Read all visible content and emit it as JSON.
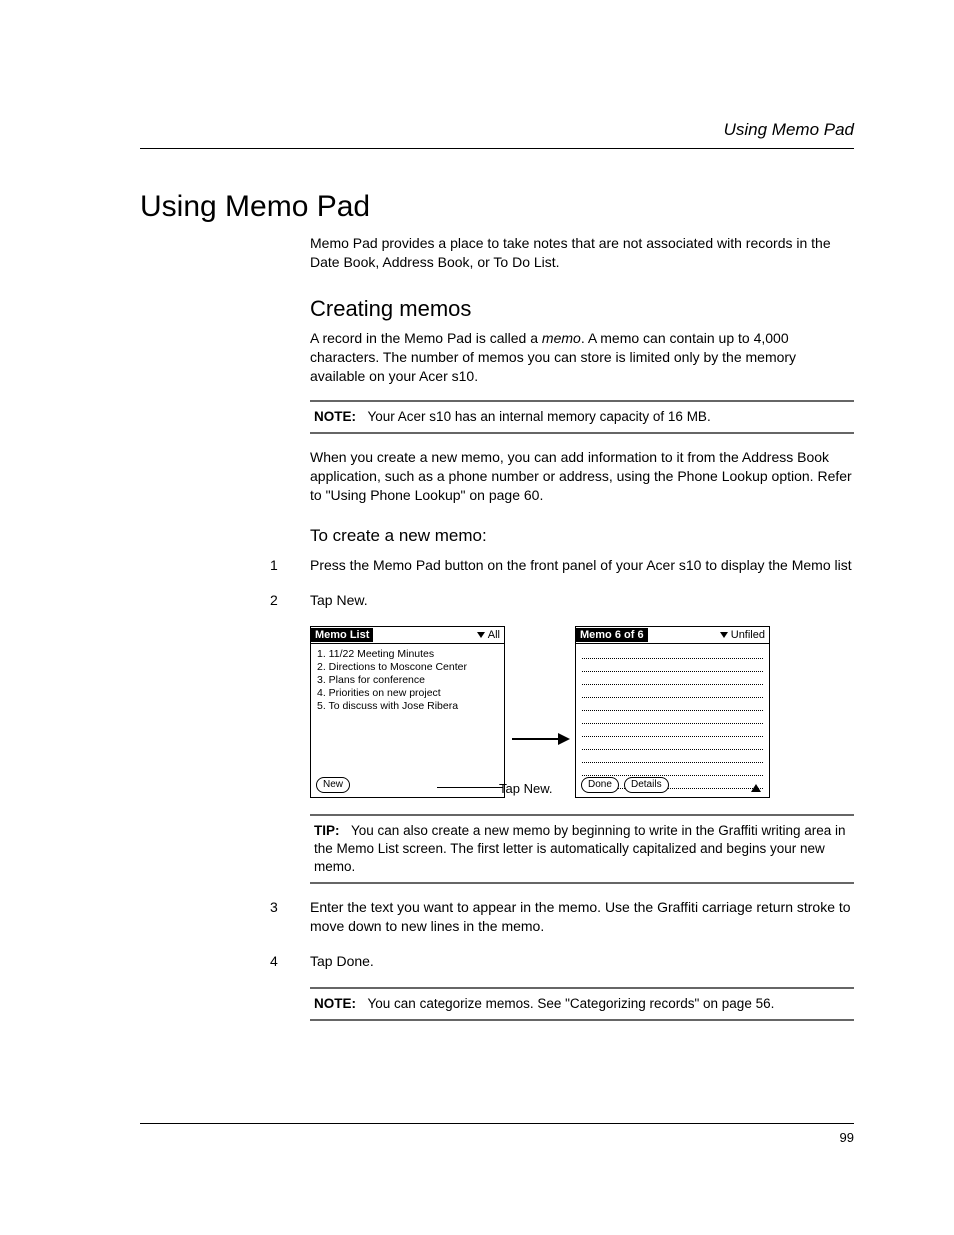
{
  "header": {
    "running_title": "Using Memo Pad"
  },
  "title": "Using Memo Pad",
  "intro": "Memo Pad provides a place to take notes that are not associated with records in the Date Book, Address Book, or To Do List.",
  "section": {
    "heading": "Creating memos",
    "p1a": "A record in the Memo Pad is called a ",
    "p1_em": "memo",
    "p1b": ". A memo can contain up to 4,000 characters. The number of memos you can store is limited only by the memory available on your Acer s10.",
    "note1": {
      "label": "NOTE:",
      "text": "Your Acer s10 has an internal memory capacity of 16 MB."
    },
    "p2": "When you create a new memo, you can add information to it from the Address Book application, such as a phone number or address, using the Phone Lookup option. Refer to \"Using Phone Lookup\" on page 60.",
    "proc_heading": "To create a new memo:",
    "steps12": [
      {
        "n": "1",
        "t": "Press the Memo Pad button on the front panel of your Acer s10 to display the Memo list"
      },
      {
        "n": "2",
        "t": "Tap New."
      }
    ],
    "figure": {
      "left": {
        "title": "Memo List",
        "dropdown": "All",
        "items": [
          "1. 11/22 Meeting Minutes",
          "2. Directions to Moscone Center",
          "3. Plans for conference",
          "4. Priorities on new project",
          "5. To discuss with Jose Ribera"
        ],
        "button_new": "New"
      },
      "arrow_label": "Tap New.",
      "right": {
        "title": "Memo 6 of 6",
        "dropdown": "Unfiled",
        "button_done": "Done",
        "button_details": "Details"
      }
    },
    "tip": {
      "label": "TIP:",
      "text": "You can also create a new memo by beginning to write in the Graffiti writing area in the Memo List screen. The first letter is automatically capitalized and begins your new memo."
    },
    "steps34": [
      {
        "n": "3",
        "t": "Enter the text you want to appear in the memo. Use the Graffiti carriage return stroke to move down to new lines in the memo."
      },
      {
        "n": "4",
        "t": "Tap Done."
      }
    ],
    "note2": {
      "label": "NOTE:",
      "text": "You can categorize memos. See \"Categorizing records\" on page 56."
    }
  },
  "page_number": "99"
}
